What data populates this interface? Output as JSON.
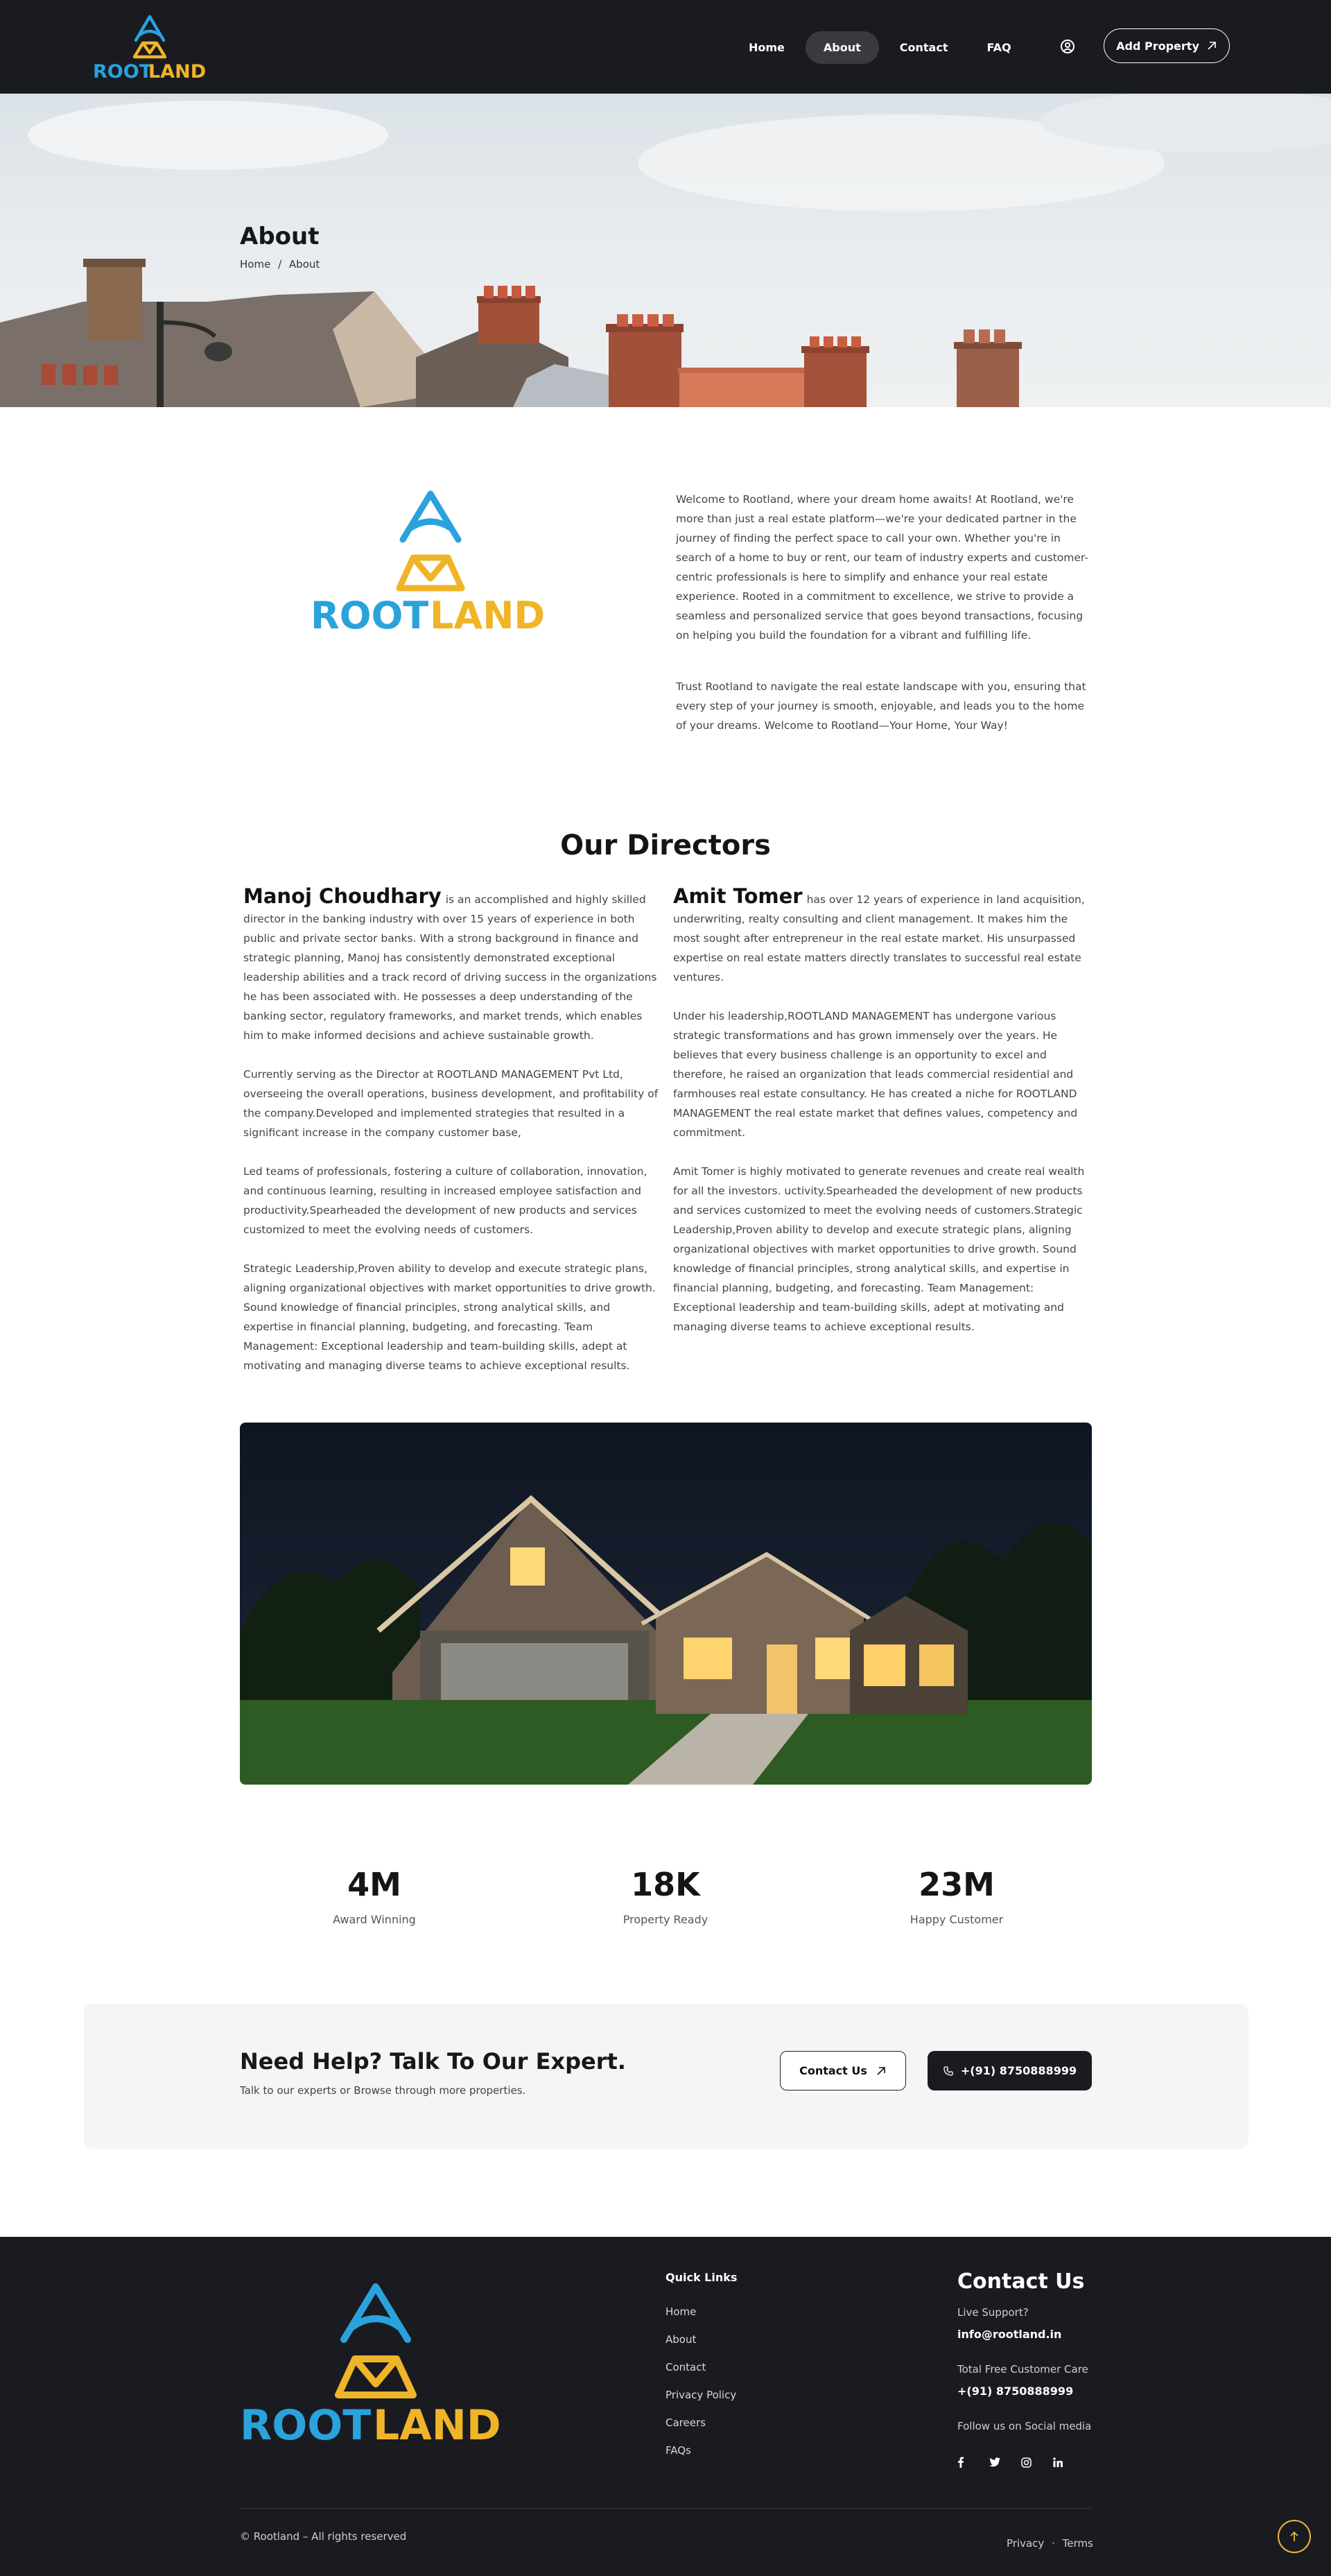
{
  "brand": {
    "name_part1": "ROOT",
    "name_part2": "LAND",
    "color_blue": "#2aa2dc",
    "color_yellow": "#f0b429"
  },
  "header": {
    "nav": [
      {
        "label": "Home",
        "active": false
      },
      {
        "label": "About",
        "active": true
      },
      {
        "label": "Contact",
        "active": false
      },
      {
        "label": "FAQ",
        "active": false
      }
    ],
    "user_icon": "user-circle-icon",
    "add_property_label": "Add Property"
  },
  "banner": {
    "title": "About",
    "breadcrumb": [
      "Home",
      "/",
      "About"
    ]
  },
  "intro": {
    "paragraph1": "Welcome to Rootland, where your dream home awaits! At Rootland, we're more than just a real estate platform—we're your dedicated partner in the journey of finding the perfect space to call your own. Whether you're in search of a home to buy or rent, our team of industry experts and customer-centric professionals is here to simplify and enhance your real estate experience. Rooted in a commitment to excellence, we strive to provide a seamless and personalized service that goes beyond transactions, focusing on helping you build the foundation for a vibrant and fulfilling life.",
    "paragraph2": "Trust Rootland to navigate the real estate landscape with you, ensuring that every step of your journey is smooth, enjoyable, and leads you to the home of your dreams. Welcome to Rootland—Your Home, Your Way!"
  },
  "directors": {
    "title": "Our Directors",
    "manoj": {
      "name": "Manoj Choudhary",
      "p1": "is an accomplished and highly skilled director in the banking industry with over 15 years of experience in both public and private sector banks. With a strong background in finance and strategic planning, Manoj has consistently demonstrated exceptional leadership abilities and a track record of driving success in the organizations he has been associated with. He possesses a deep understanding of the banking sector, regulatory frameworks, and market trends, which enables him to make informed decisions and achieve sustainable growth.",
      "p2": "Currently serving as the Director at ROOTLAND MANAGEMENT Pvt Ltd, overseeing the overall operations, business development, and profitability of the company.Developed and implemented strategies that resulted in a significant increase in the company customer base,",
      "p3": "Led teams of professionals, fostering a culture of collaboration, innovation, and continuous learning, resulting in increased employee satisfaction and productivity.Spearheaded the development of new products and services customized to meet the evolving needs of customers.",
      "p4": "Strategic Leadership,Proven ability to develop and execute strategic plans, aligning organizational objectives with market opportunities to drive growth. Sound knowledge of financial principles, strong analytical skills, and expertise in financial planning, budgeting, and forecasting. Team Management: Exceptional leadership and team-building skills, adept at motivating and managing diverse teams to achieve exceptional results."
    },
    "amit": {
      "name": "Amit Tomer",
      "p1": "has over 12 years of experience in land acquisition, underwriting, realty consulting and client management. It makes him the most sought after entrepreneur in the real estate market. His unsurpassed expertise on real estate matters directly translates to successful real estate ventures.",
      "p2": " Under his leadership,ROOTLAND MANAGEMENT has undergone various strategic transformations and has grown immensely over the years. He believes that every business challenge is an opportunity to excel and therefore, he raised an organization that leads commercial residential and farmhouses real estate consultancy. He has created a niche for ROOTLAND MANAGEMENT the real estate market that defines values, competency and commitment.",
      "p3": "Amit Tomer is highly motivated to generate revenues and create real wealth for all the  investors. uctivity.Spearheaded the development of new products and services customized to meet the evolving needs of customers.Strategic Leadership,Proven ability to develop and execute strategic plans, aligning organizational objectives with market opportunities to drive growth. Sound knowledge of financial principles, strong analytical skills, and expertise in financial planning, budgeting, and forecasting. Team Management: Exceptional leadership and team-building skills, adept at motivating and managing diverse teams to achieve exceptional results."
    }
  },
  "stats": [
    {
      "value": "4M",
      "label": "Award Winning"
    },
    {
      "value": "18K",
      "label": "Property Ready"
    },
    {
      "value": "23M",
      "label": "Happy Customer"
    }
  ],
  "help": {
    "title": "Need Help? Talk To Our Expert.",
    "subtitle": "Talk to our experts or Browse through more properties.",
    "contact_label": "Contact Us",
    "phone_label": "+(91) 8750888999"
  },
  "footer": {
    "quick_links_title": "Quick Links",
    "quick_links": [
      "Home",
      "About",
      "Contact",
      "Privacy Policy",
      "Careers",
      "FAQs"
    ],
    "contact_title": "Contact Us",
    "live_support_label": "Live Support?",
    "email": "info@rootland.in",
    "care_label": "Total Free Customer Care",
    "care_phone": "+(91) 8750888999",
    "social_label": "Follow us on Social media",
    "socials": [
      "facebook-icon",
      "twitter-icon",
      "instagram-icon",
      "linkedin-icon"
    ],
    "copyright": "© Rootland – All rights reserved",
    "privacy": "Privacy",
    "dot": "·",
    "terms": "Terms"
  }
}
